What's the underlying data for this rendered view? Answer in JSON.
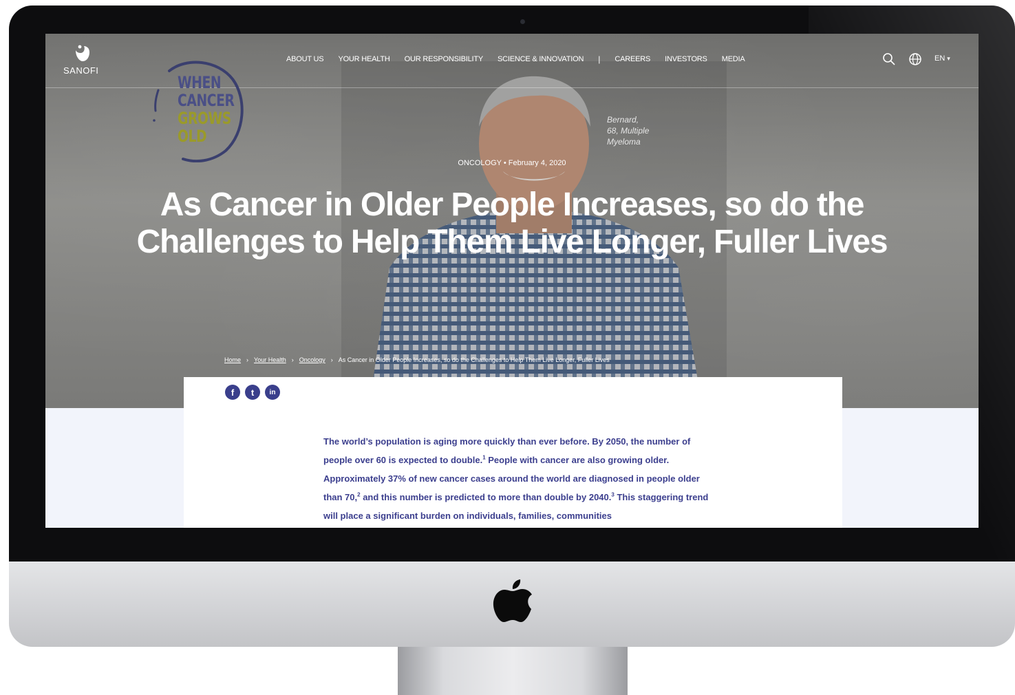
{
  "nav": {
    "brand": "SANOFI",
    "menu": [
      {
        "label": "ABOUT US"
      },
      {
        "label": "YOUR HEALTH"
      },
      {
        "label": "OUR RESPONSIBILITY"
      },
      {
        "label": "SCIENCE & INNOVATION"
      },
      {
        "label": "CAREERS"
      },
      {
        "label": "INVESTORS"
      },
      {
        "label": "MEDIA"
      }
    ],
    "separator": "|",
    "language": "EN"
  },
  "badge": {
    "lines": [
      "WHEN",
      "CANCER",
      "GROWS",
      "OLD"
    ],
    "colors": {
      "dark": "#4a4f86",
      "olive": "#9a9a2a"
    }
  },
  "caption": {
    "lines": [
      "Bernard,",
      "68, Multiple",
      "Myeloma"
    ]
  },
  "meta": {
    "category": "ONCOLOGY",
    "separator": "•",
    "date": "February 4, 2020"
  },
  "title": "As Cancer in Older People Increases, so do the Challenges to Help Them Live Longer, Fuller Lives",
  "breadcrumb": {
    "items": [
      "Home",
      "Your Health",
      "Oncology",
      "As Cancer in Older People Increases, so do the Challenges to Help Them Live Longer, Fuller Lives"
    ],
    "separator": "›"
  },
  "share": {
    "buttons": [
      {
        "icon": "facebook-icon",
        "glyph": "f"
      },
      {
        "icon": "twitter-icon",
        "glyph": "t"
      },
      {
        "icon": "linkedin-icon",
        "glyph": "in"
      }
    ]
  },
  "article": {
    "p1_a": "The world’s population is aging more quickly than ever before. By 2050, the number of people over 60 is expected to double.",
    "ref1": "1",
    "p1_b": " People with cancer are also growing older. Approximately 37% of new cancer cases around the world are diagnosed in people older than 70,",
    "ref2": "2",
    "p1_c": " and this number is predicted to more than double by 2040.",
    "ref3": "3",
    "p1_d": " This staggering trend will place a significant burden on individuals, families, communities"
  },
  "colors": {
    "accent": "#3a3f8c",
    "body_text": "#3c3f8e",
    "page_bg": "#f2f4fb",
    "bezel": "#0d0d0f"
  }
}
